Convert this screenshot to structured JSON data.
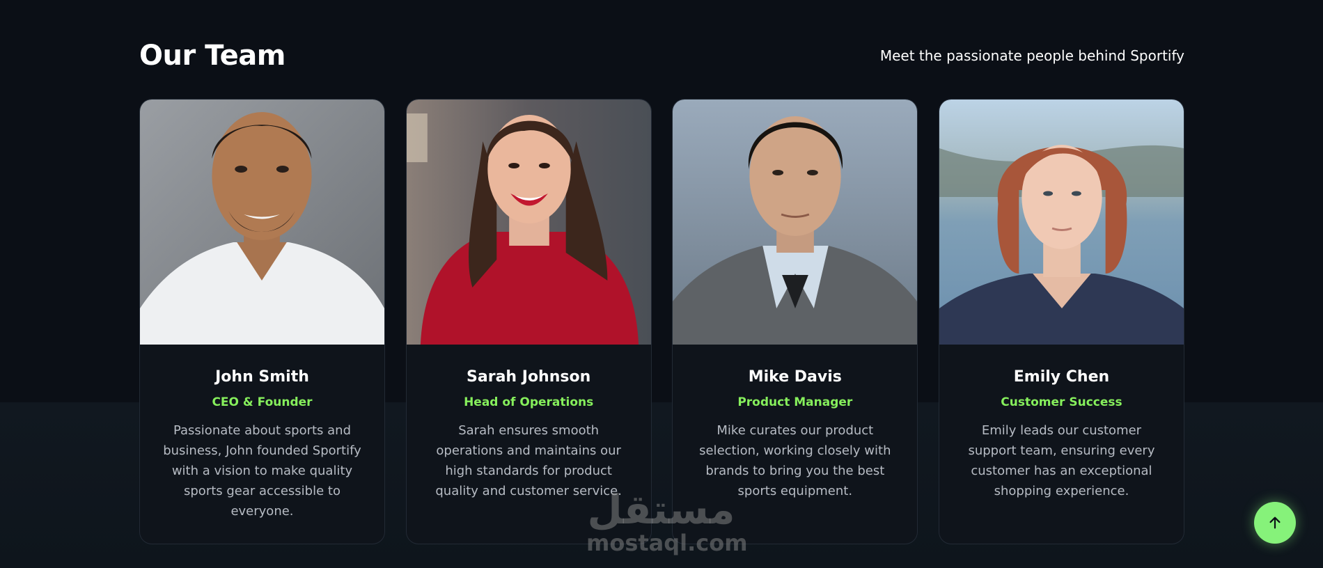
{
  "header": {
    "title": "Our Team",
    "subtitle": "Meet the passionate people behind Sportify"
  },
  "members": [
    {
      "name": "John Smith",
      "role": "CEO & Founder",
      "bio": "Passionate about sports and business, John founded Sportify with a vision to make quality sports gear accessible to everyone."
    },
    {
      "name": "Sarah Johnson",
      "role": "Head of Operations",
      "bio": "Sarah ensures smooth operations and maintains our high standards for product quality and customer service."
    },
    {
      "name": "Mike Davis",
      "role": "Product Manager",
      "bio": "Mike curates our product selection, working closely with brands to bring you the best sports equipment."
    },
    {
      "name": "Emily Chen",
      "role": "Customer Success",
      "bio": "Emily leads our customer support team, ensuring every customer has an exceptional shopping experience."
    }
  ],
  "watermark": {
    "arabic": "مستقل",
    "latin": "mostaql.com"
  },
  "colors": {
    "accent": "#86ef5c",
    "background": "#0b0f16",
    "card": "#0f141b"
  },
  "icons": {
    "scroll_top": "arrow-up-icon"
  }
}
